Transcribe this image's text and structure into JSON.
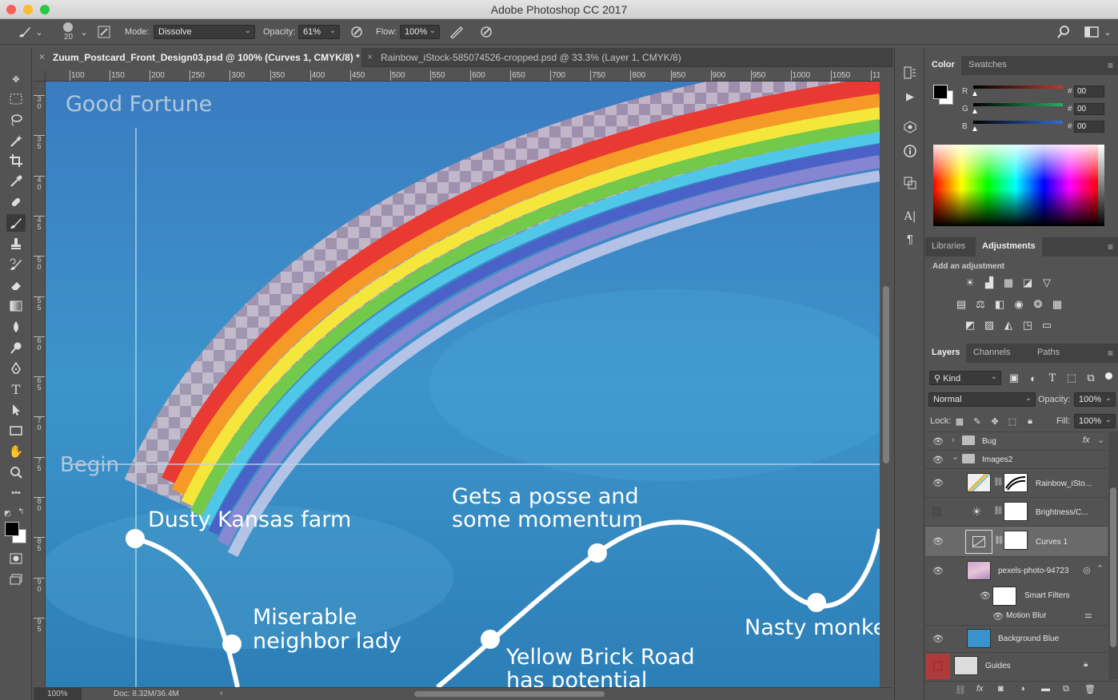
{
  "window": {
    "title": "Adobe Photoshop CC 2017"
  },
  "options_bar": {
    "brush_size": "20",
    "mode_label": "Mode:",
    "mode_value": "Dissolve",
    "opacity_label": "Opacity:",
    "opacity_value": "61%",
    "flow_label": "Flow:",
    "flow_value": "100%"
  },
  "tabs": [
    {
      "label": "Zuum_Postcard_Front_Design03.psd @ 100% (Curves 1, CMYK/8) *",
      "active": true
    },
    {
      "label": "Rainbow_iStock-585074526-cropped.psd @ 33.3% (Layer 1, CMYK/8)",
      "active": false
    }
  ],
  "rulers": {
    "top": [
      "100",
      "150",
      "200",
      "250",
      "300",
      "350",
      "400",
      "450",
      "500",
      "550",
      "600",
      "650",
      "700",
      "750",
      "800",
      "850",
      "900",
      "950",
      "1000",
      "1050",
      "11"
    ],
    "left": [
      "3 0",
      "3 5",
      "4 0",
      "4 5",
      "5 0",
      "5 5",
      "6 0",
      "6 5",
      "7 0",
      "7 5",
      "8 0",
      "8 5",
      "9 0",
      "9 5"
    ]
  },
  "canvas": {
    "title": "Good Fortune",
    "begin": "Begin",
    "labels": {
      "farm": "Dusty Kansas farm",
      "posse_1": "Gets a posse and",
      "posse_2": "some momentum",
      "neighbor_1": "Miserable",
      "neighbor_2": "neighbor lady",
      "road_1": "Yellow Brick Road",
      "road_2": "has potential",
      "monkey": "Nasty monke"
    }
  },
  "status": {
    "zoom": "100%",
    "doc": "Doc: 8.32M/36.4M"
  },
  "color_panel": {
    "tabs": [
      "Color",
      "Swatches"
    ],
    "channels": [
      {
        "label": "R",
        "value": "00",
        "color": "#c0392b"
      },
      {
        "label": "G",
        "value": "00",
        "color": "#27ae60"
      },
      {
        "label": "B",
        "value": "00",
        "color": "#2f6fd6"
      }
    ],
    "hash": "#"
  },
  "adjust_panel": {
    "tabs": [
      "Libraries",
      "Adjustments"
    ],
    "heading": "Add an adjustment"
  },
  "layers_panel": {
    "tabs": [
      "Layers",
      "Channels",
      "Paths"
    ],
    "kind": "Kind",
    "blend_mode": "Normal",
    "opacity_label": "Opacity:",
    "opacity_value": "100%",
    "lock_label": "Lock:",
    "fill_label": "Fill:",
    "fill_value": "100%",
    "layers": {
      "bug": "Bug",
      "images2": "Images2",
      "rainbow": "Rainbow_iSto...",
      "brightness": "Brightness/C...",
      "curves": "Curves 1",
      "pexels": "pexels-photo-94723",
      "smart_filters": "Smart Filters",
      "motion_blur": "Motion Blur",
      "background": "Background Blue",
      "guides": "Guides"
    }
  },
  "colors": {
    "sky": "#3d8fc8",
    "panel_bg": "#535353",
    "ui_dark": "#424242",
    "highlight": "#6a6a6a"
  }
}
